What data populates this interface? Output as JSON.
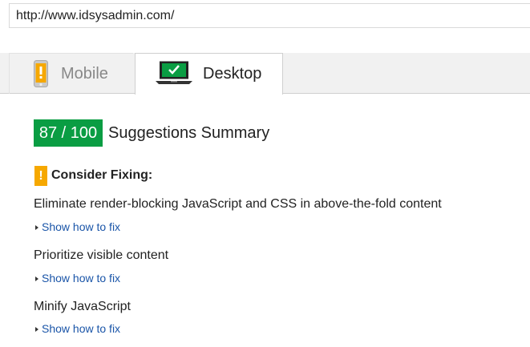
{
  "url_bar": {
    "value": "http://www.idsysadmin.com/"
  },
  "tabs": [
    {
      "label": "Mobile",
      "icon": "mobile-phone-icon",
      "selected": false
    },
    {
      "label": "Desktop",
      "icon": "desktop-monitor-icon",
      "selected": true
    }
  ],
  "score": {
    "badge": "87 / 100",
    "title": "Suggestions Summary",
    "color": "#0a9d43"
  },
  "consider_fixing": {
    "icon_text": "!",
    "icon": "warning-icon",
    "title": "Consider Fixing:",
    "color": "#f6a800",
    "rules": [
      {
        "title": "Eliminate render-blocking JavaScript and CSS in above-the-fold content",
        "link": "Show how to fix"
      },
      {
        "title": "Prioritize visible content",
        "link": "Show how to fix"
      },
      {
        "title": "Minify JavaScript",
        "link": "Show how to fix"
      }
    ]
  }
}
